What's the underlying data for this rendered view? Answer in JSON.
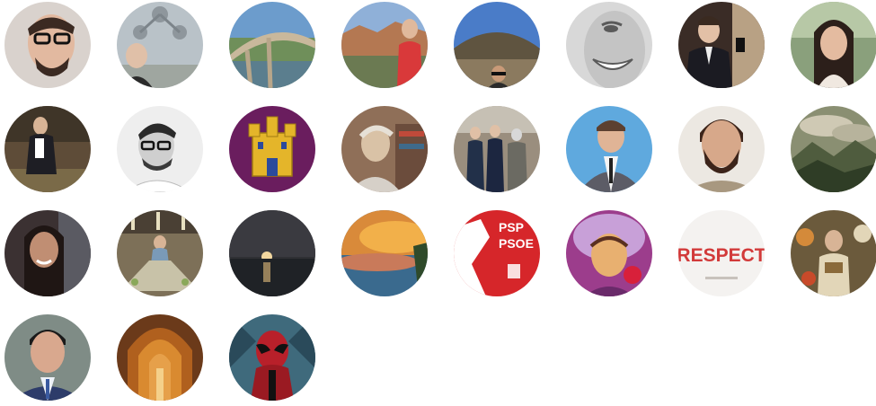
{
  "avatars": [
    {
      "id": "avatar-1",
      "kind": "man-glasses-beard",
      "bg": "#d9d2cd",
      "accent": "#3b2a22"
    },
    {
      "id": "avatar-2",
      "kind": "man-atomium",
      "bg": "#b9c2c8",
      "accent": "#2b2b2b"
    },
    {
      "id": "avatar-3",
      "kind": "bridge-landscape",
      "bg": "#6c9ccc",
      "accent": "#c9b89c"
    },
    {
      "id": "avatar-4",
      "kind": "town-red-shirt",
      "bg": "#8fb0d8",
      "accent": "#d9393a"
    },
    {
      "id": "avatar-5",
      "kind": "mountain-selfie",
      "bg": "#4a7cc8",
      "accent": "#7a6a55"
    },
    {
      "id": "avatar-6",
      "kind": "smiling-bw",
      "bg": "#d8d8d8",
      "accent": "#5a5a5a"
    },
    {
      "id": "avatar-7",
      "kind": "man-suit-mirror",
      "bg": "#3a2c26",
      "accent": "#b8a184"
    },
    {
      "id": "avatar-8",
      "kind": "woman-dark-hair",
      "bg": "#8aa07c",
      "accent": "#2c1f1a"
    },
    {
      "id": "avatar-9",
      "kind": "man-crouching-field",
      "bg": "#5e4c38",
      "accent": "#1e1e24"
    },
    {
      "id": "avatar-10",
      "kind": "man-glasses-bw",
      "bg": "#eeeeee",
      "accent": "#2a2a2a"
    },
    {
      "id": "avatar-11",
      "kind": "castile-flag",
      "bg": "#6a1d5e",
      "accent": "#e4b52a"
    },
    {
      "id": "avatar-12",
      "kind": "man-thinking-library",
      "bg": "#8f6f58",
      "accent": "#d9c2a6"
    },
    {
      "id": "avatar-13",
      "kind": "group-outdoor",
      "bg": "#9a8e7e",
      "accent": "#223049"
    },
    {
      "id": "avatar-14",
      "kind": "man-vest-blue",
      "bg": "#5fa9de",
      "accent": "#5c5c66"
    },
    {
      "id": "avatar-15",
      "kind": "man-red-beard",
      "bg": "#ece8e2",
      "accent": "#3c241a"
    },
    {
      "id": "avatar-16",
      "kind": "cloudy-mountains",
      "bg": "#8a8f72",
      "accent": "#2f3d26"
    },
    {
      "id": "avatar-17",
      "kind": "woman-smiling-selfie",
      "bg": "#3b3132",
      "accent": "#c08e73"
    },
    {
      "id": "avatar-18",
      "kind": "man-long-table",
      "bg": "#7d7058",
      "accent": "#c8c2a8"
    },
    {
      "id": "avatar-19",
      "kind": "sunset-sea",
      "bg": "#2f3034",
      "accent": "#f2d7a0"
    },
    {
      "id": "avatar-20",
      "kind": "sunset-sky",
      "bg": "#d98a3a",
      "accent": "#3a6a8e"
    },
    {
      "id": "avatar-21",
      "kind": "psoe-logo",
      "bg": "#d6262a",
      "accent": "#ffffff",
      "text": [
        "PSP",
        "PSOE"
      ]
    },
    {
      "id": "avatar-22",
      "kind": "purple-portrait",
      "bg": "#9c3d8c",
      "accent": "#e8b070"
    },
    {
      "id": "avatar-23",
      "kind": "respect-text",
      "bg": "#f4f2f0",
      "accent": "#d23a3a",
      "text": [
        "RESPECT"
      ]
    },
    {
      "id": "avatar-24",
      "kind": "costume-figure",
      "bg": "#6b5a3c",
      "accent": "#e2d6b8"
    },
    {
      "id": "avatar-25",
      "kind": "man-tie-portrait",
      "bg": "#7f8c86",
      "accent": "#2d3c6a"
    },
    {
      "id": "avatar-26",
      "kind": "gothic-arches",
      "bg": "#6b3a1a",
      "accent": "#e6a04a"
    },
    {
      "id": "avatar-27",
      "kind": "deadpool",
      "bg": "#3f6a7c",
      "accent": "#b8202a"
    }
  ]
}
